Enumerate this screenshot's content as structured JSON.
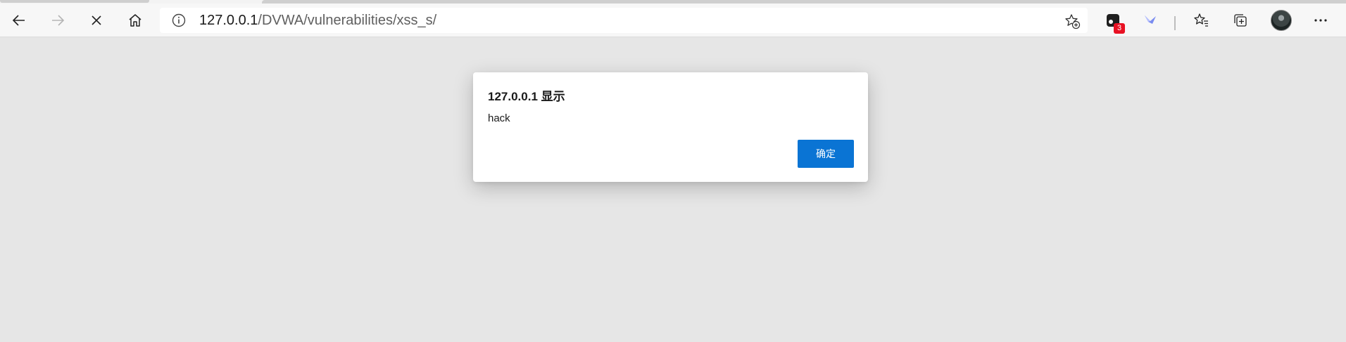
{
  "browser": {
    "url_host": "127.0.0.1",
    "url_path": "/DVWA/vulnerabilities/xss_s/",
    "extension_badge_count": "3",
    "icons": {
      "back": "arrow-left-icon",
      "forward": "arrow-right-icon",
      "stop": "close-icon",
      "home": "home-icon",
      "site_info": "info-icon",
      "add_favorite": "star-plus-icon",
      "extension_1": "extension-icon",
      "extension_2": "bird-icon",
      "favorites": "favorites-icon",
      "collections": "collections-icon",
      "profile": "avatar",
      "more": "more-icon"
    }
  },
  "alert_dialog": {
    "title": "127.0.0.1 显示",
    "message": "hack",
    "ok_label": "确定",
    "button_color": "#0a74d4"
  }
}
